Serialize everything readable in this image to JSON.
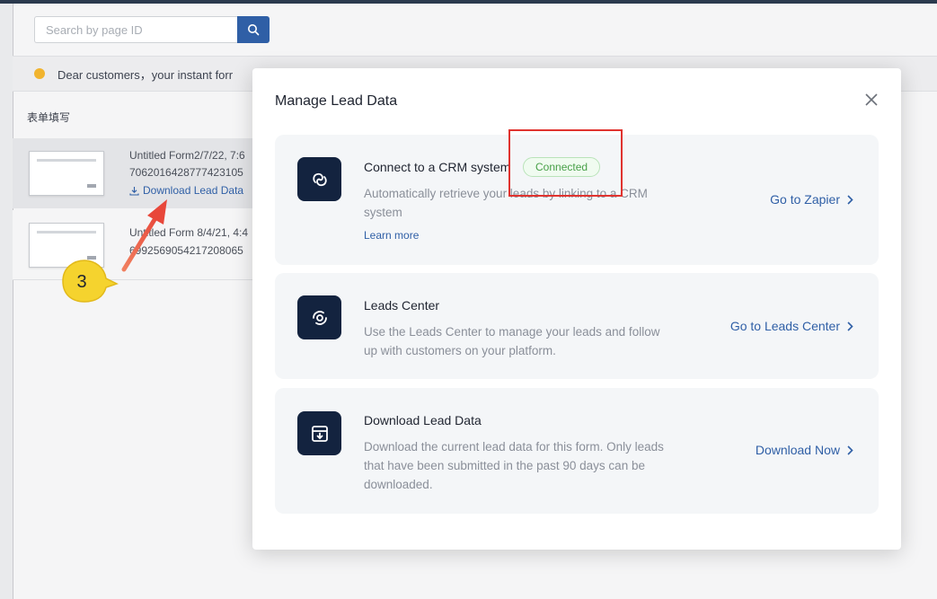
{
  "background": {
    "search": {
      "placeholder": "Search by page ID"
    },
    "notice": "Dear customers，your instant forr",
    "section_label": "表单填写",
    "forms": [
      {
        "title": "Untitled Form2/7/22, 7:6",
        "id": "7062016428777423105",
        "download_label": "Download Lead Data"
      },
      {
        "title": "Untitled Form 8/4/21, 4:4",
        "id": "6992569054217208065"
      }
    ],
    "annotation_number": "3",
    "annotation_color": "#f5d32e",
    "arrow_color": "#e8473a"
  },
  "modal": {
    "title": "Manage Lead Data",
    "cards": [
      {
        "icon": "crm-link-icon",
        "title": "Connect to a CRM system",
        "badge": "Connected",
        "description": "Automatically retrieve your leads by linking to a CRM system",
        "link": "Learn more",
        "action": "Go to Zapier"
      },
      {
        "icon": "leads-center-icon",
        "title": "Leads Center",
        "description": "Use the Leads Center to manage your leads and follow up with customers on your platform.",
        "action": "Go to Leads Center"
      },
      {
        "icon": "download-box-icon",
        "title": "Download Lead Data",
        "description": "Download the current lead data for this form. Only leads that have been submitted in the past 90 days can be downloaded.",
        "action": "Download Now"
      }
    ]
  },
  "colors": {
    "accent": "#2f5fa6",
    "icon_bg": "#13233f",
    "connected": "#48a048",
    "highlight": "#e0332f"
  }
}
